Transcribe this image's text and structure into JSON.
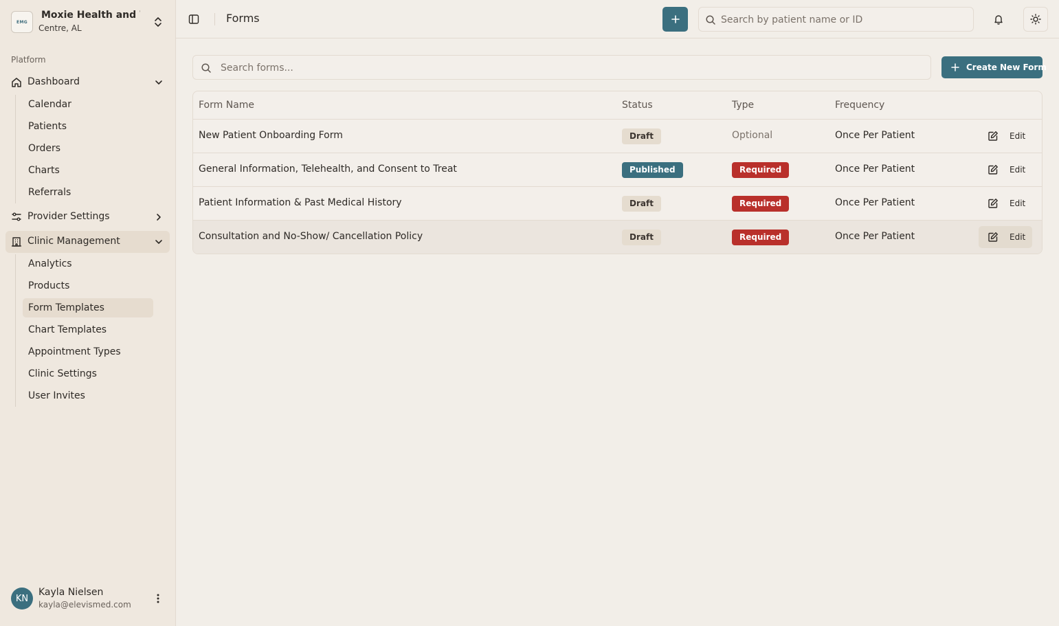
{
  "org": {
    "logo_text": "EMG",
    "name": "Moxie Health and Wellness",
    "location": "Centre, AL"
  },
  "sidebar": {
    "section_label": "Platform",
    "groups": [
      {
        "label": "Dashboard",
        "icon": "home-icon",
        "expanded": true,
        "active": false,
        "items": [
          {
            "label": "Calendar"
          },
          {
            "label": "Patients"
          },
          {
            "label": "Orders"
          },
          {
            "label": "Charts"
          },
          {
            "label": "Referrals"
          }
        ]
      },
      {
        "label": "Provider Settings",
        "icon": "sliders-icon",
        "expanded": false,
        "active": false,
        "items": []
      },
      {
        "label": "Clinic Management",
        "icon": "building-icon",
        "expanded": true,
        "active": true,
        "items": [
          {
            "label": "Analytics"
          },
          {
            "label": "Products"
          },
          {
            "label": "Form Templates",
            "active": true
          },
          {
            "label": "Chart Templates"
          },
          {
            "label": "Appointment Types"
          },
          {
            "label": "Clinic Settings"
          },
          {
            "label": "User Invites"
          }
        ]
      }
    ]
  },
  "user": {
    "initials": "KN",
    "name": "Kayla Nielsen",
    "email": "kayla@elevismed.com"
  },
  "topbar": {
    "title": "Forms",
    "search_placeholder": "Search by patient name or ID"
  },
  "forms": {
    "search_placeholder": "Search forms...",
    "create_label": "Create New Form",
    "columns": {
      "name": "Form Name",
      "status": "Status",
      "type": "Type",
      "frequency": "Frequency"
    },
    "rows": [
      {
        "name": "New Patient Onboarding Form",
        "status": "Draft",
        "type": "Optional",
        "frequency": "Once Per Patient",
        "edit": "Edit"
      },
      {
        "name": "General Information, Telehealth, and Consent to Treat",
        "status": "Published",
        "type": "Required",
        "frequency": "Once Per Patient",
        "edit": "Edit"
      },
      {
        "name": "Patient Information & Past Medical History",
        "status": "Draft",
        "type": "Required",
        "frequency": "Once Per Patient",
        "edit": "Edit"
      },
      {
        "name": "Consultation and No-Show/ Cancellation Policy",
        "status": "Draft",
        "type": "Required",
        "frequency": "Once Per Patient",
        "edit": "Edit"
      }
    ]
  },
  "colors": {
    "accent": "#3b6f7f",
    "required": "#b9302b",
    "draft": "#e5dccf",
    "sidebar_bg": "#efe8df",
    "page_bg": "#f2eee8"
  }
}
